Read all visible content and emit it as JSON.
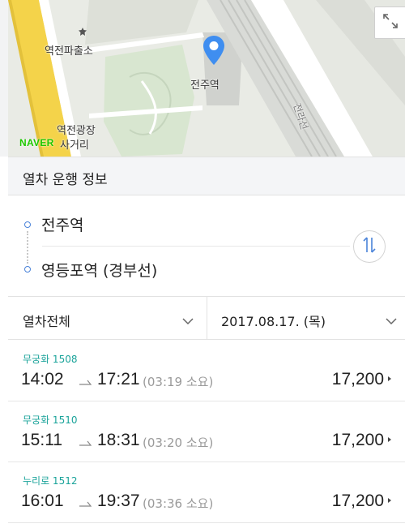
{
  "map": {
    "labels": {
      "police_box": "역전파출소",
      "station": "전주역",
      "square_line1": "역전광장",
      "square_line2": "사거리",
      "rail_line": "전라선"
    },
    "logo": "NAVER",
    "icons": {
      "expand": "expand-arrows-icon",
      "pin": "location-pin-icon",
      "police": "police-icon"
    },
    "colors": {
      "road": "#f4d34a",
      "pin": "#3f8ef0",
      "land": "#e8ebe3",
      "park": "#d7e6cf",
      "logo": "#1ec800"
    }
  },
  "header": {
    "title": "열차 운행 정보"
  },
  "route": {
    "from": "전주역",
    "to": "영등포역 (경부선)",
    "swap_icon": "swap-vertical-icon"
  },
  "filters": {
    "train_type": "열차전체",
    "date": "2017.08.17. (목)"
  },
  "trains": [
    {
      "name": "무궁화 1508",
      "depart": "14:02",
      "arrive": "17:21",
      "duration": "(03:19 소요)",
      "fare": "17,200"
    },
    {
      "name": "무궁화 1510",
      "depart": "15:11",
      "arrive": "18:31",
      "duration": "(03:20 소요)",
      "fare": "17,200"
    },
    {
      "name": "누리로 1512",
      "depart": "16:01",
      "arrive": "19:37",
      "duration": "(03:36 소요)",
      "fare": "17,200"
    }
  ],
  "colors": {
    "accent": "#4a83d9",
    "train_name": "#1aa39a",
    "duration": "#9a9a9a"
  }
}
